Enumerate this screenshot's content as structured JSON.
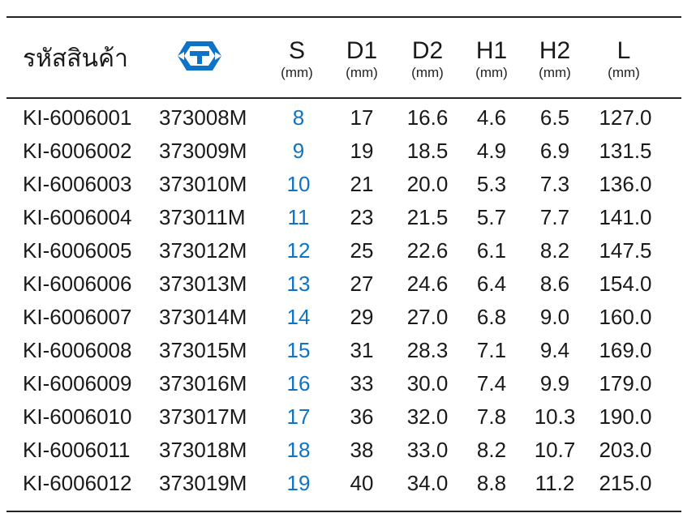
{
  "header": {
    "code_label": "รหัสสินค้า",
    "logo_icon": "brand-wrench-logo-icon",
    "columns": [
      {
        "key": "S",
        "label": "S",
        "unit": "(mm)"
      },
      {
        "key": "D1",
        "label": "D1",
        "unit": "(mm)"
      },
      {
        "key": "D2",
        "label": "D2",
        "unit": "(mm)"
      },
      {
        "key": "H1",
        "label": "H1",
        "unit": "(mm)"
      },
      {
        "key": "H2",
        "label": "H2",
        "unit": "(mm)"
      },
      {
        "key": "L",
        "label": "L",
        "unit": "(mm)"
      }
    ]
  },
  "colors": {
    "accent_blue": "#0d73c6",
    "rule": "#222222"
  },
  "rows": [
    {
      "code": "KI-6006001",
      "part": "373008M",
      "s": "8",
      "d1": "17",
      "d2": "16.6",
      "h1": "4.6",
      "h2": "6.5",
      "l": "127.0"
    },
    {
      "code": "KI-6006002",
      "part": "373009M",
      "s": "9",
      "d1": "19",
      "d2": "18.5",
      "h1": "4.9",
      "h2": "6.9",
      "l": "131.5"
    },
    {
      "code": "KI-6006003",
      "part": "373010M",
      "s": "10",
      "d1": "21",
      "d2": "20.0",
      "h1": "5.3",
      "h2": "7.3",
      "l": "136.0"
    },
    {
      "code": "KI-6006004",
      "part": "373011M",
      "s": "11",
      "d1": "23",
      "d2": "21.5",
      "h1": "5.7",
      "h2": "7.7",
      "l": "141.0"
    },
    {
      "code": "KI-6006005",
      "part": "373012M",
      "s": "12",
      "d1": "25",
      "d2": "22.6",
      "h1": "6.1",
      "h2": "8.2",
      "l": "147.5"
    },
    {
      "code": "KI-6006006",
      "part": "373013M",
      "s": "13",
      "d1": "27",
      "d2": "24.6",
      "h1": "6.4",
      "h2": "8.6",
      "l": "154.0"
    },
    {
      "code": "KI-6006007",
      "part": "373014M",
      "s": "14",
      "d1": "29",
      "d2": "27.0",
      "h1": "6.8",
      "h2": "9.0",
      "l": "160.0"
    },
    {
      "code": "KI-6006008",
      "part": "373015M",
      "s": "15",
      "d1": "31",
      "d2": "28.3",
      "h1": "7.1",
      "h2": "9.4",
      "l": "169.0"
    },
    {
      "code": "KI-6006009",
      "part": "373016M",
      "s": "16",
      "d1": "33",
      "d2": "30.0",
      "h1": "7.4",
      "h2": "9.9",
      "l": "179.0"
    },
    {
      "code": "KI-6006010",
      "part": "373017M",
      "s": "17",
      "d1": "36",
      "d2": "32.0",
      "h1": "7.8",
      "h2": "10.3",
      "l": "190.0"
    },
    {
      "code": "KI-6006011",
      "part": "373018M",
      "s": "18",
      "d1": "38",
      "d2": "33.0",
      "h1": "8.2",
      "h2": "10.7",
      "l": "203.0"
    },
    {
      "code": "KI-6006012",
      "part": "373019M",
      "s": "19",
      "d1": "40",
      "d2": "34.0",
      "h1": "8.8",
      "h2": "11.2",
      "l": "215.0"
    }
  ]
}
